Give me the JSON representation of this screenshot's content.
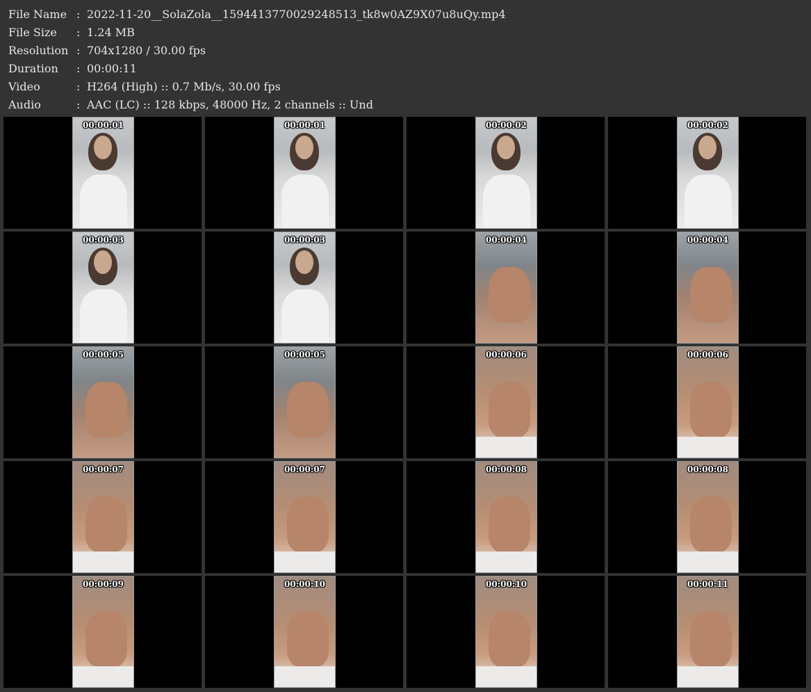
{
  "info": [
    {
      "label": "File Name",
      "sep": ":",
      "value": "2022-11-20__SolaZola__1594413770029248513_tk8w0AZ9X07u8uQy.mp4"
    },
    {
      "label": "File Size",
      "sep": ":",
      "value": "1.24 MB"
    },
    {
      "label": "Resolution",
      "sep": ":",
      "value": "704x1280 / 30.00 fps"
    },
    {
      "label": "Duration",
      "sep": ":",
      "value": "00:00:11"
    },
    {
      "label": "Video",
      "sep": ":",
      "value": "H264 (High) :: 0.7 Mb/s, 30.00 fps"
    },
    {
      "label": "Audio",
      "sep": ":",
      "value": "AAC (LC) :: 128 kbps, 48000 Hz, 2 channels :: Und"
    }
  ],
  "thumbnails": [
    {
      "time": "00:00:01",
      "scene": "portrait"
    },
    {
      "time": "00:00:01",
      "scene": "portrait"
    },
    {
      "time": "00:00:02",
      "scene": "portrait"
    },
    {
      "time": "00:00:02",
      "scene": "portrait"
    },
    {
      "time": "00:00:03",
      "scene": "portrait"
    },
    {
      "time": "00:00:03",
      "scene": "portrait"
    },
    {
      "time": "00:00:04",
      "scene": "legs-terrace"
    },
    {
      "time": "00:00:04",
      "scene": "legs-terrace"
    },
    {
      "time": "00:00:05",
      "scene": "legs-terrace"
    },
    {
      "time": "00:00:05",
      "scene": "legs-terrace"
    },
    {
      "time": "00:00:06",
      "scene": "legs-closeup"
    },
    {
      "time": "00:00:06",
      "scene": "legs-closeup"
    },
    {
      "time": "00:00:07",
      "scene": "legs-closeup"
    },
    {
      "time": "00:00:07",
      "scene": "legs-closeup"
    },
    {
      "time": "00:00:08",
      "scene": "legs-closeup"
    },
    {
      "time": "00:00:08",
      "scene": "legs-closeup"
    },
    {
      "time": "00:00:09",
      "scene": "legs-closeup"
    },
    {
      "time": "00:00:10",
      "scene": "legs-closeup"
    },
    {
      "time": "00:00:10",
      "scene": "legs-closeup"
    },
    {
      "time": "00:00:11",
      "scene": "legs-closeup"
    }
  ]
}
